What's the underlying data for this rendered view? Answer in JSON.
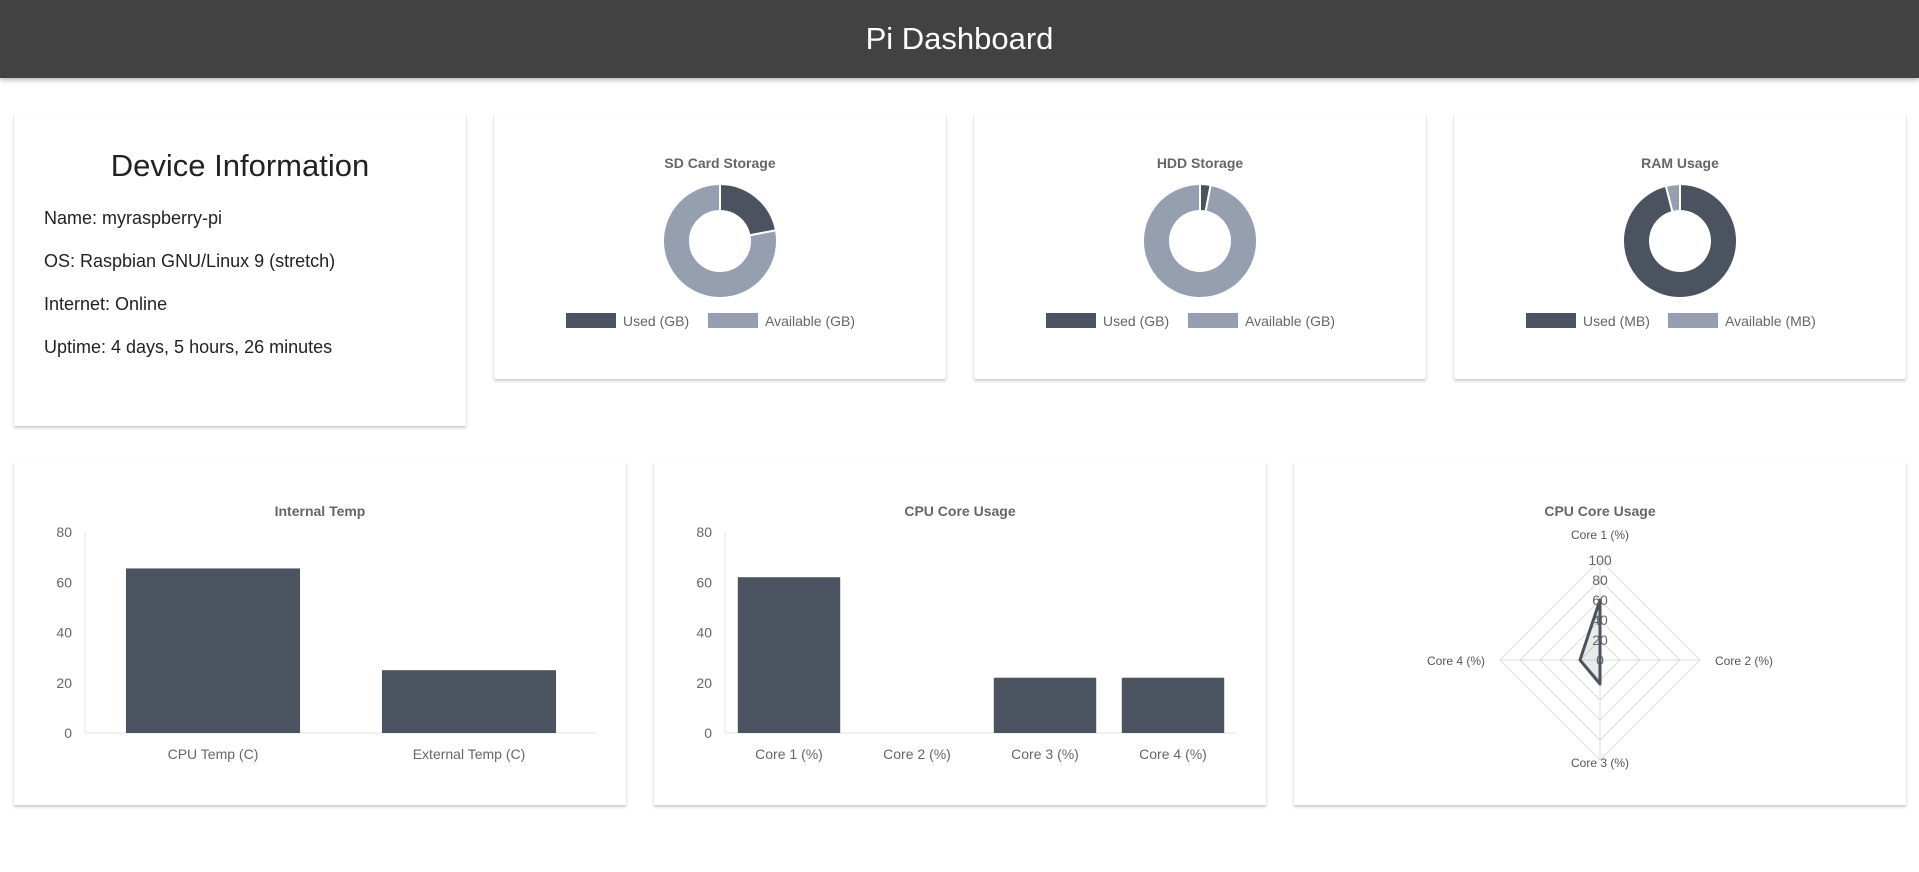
{
  "header": {
    "title": "Pi Dashboard"
  },
  "device": {
    "title": "Device Information",
    "name": "Name: myraspberry-pi",
    "os": "OS: Raspbian GNU/Linux 9 (stretch)",
    "internet": "Internet: Online",
    "uptime": "Uptime: 4 days, 5 hours, 26 minutes"
  },
  "colors": {
    "used": "#4b5260",
    "available": "#959fb0"
  },
  "chart_data": [
    {
      "type": "pie",
      "title": "SD Card Storage",
      "labels": [
        "Used (GB)",
        "Available (GB)"
      ],
      "values": [
        22,
        78
      ]
    },
    {
      "type": "pie",
      "title": "HDD Storage",
      "labels": [
        "Used (GB)",
        "Available (GB)"
      ],
      "values": [
        3,
        97
      ]
    },
    {
      "type": "pie",
      "title": "RAM Usage",
      "labels": [
        "Used (MB)",
        "Available (MB)"
      ],
      "values": [
        96,
        4
      ]
    },
    {
      "type": "bar",
      "title": "Internal Temp",
      "categories": [
        "CPU Temp (C)",
        "External Temp (C)"
      ],
      "values": [
        65.5,
        25
      ],
      "ylim": [
        0,
        80
      ],
      "yticks": [
        0,
        20,
        40,
        60,
        80
      ]
    },
    {
      "type": "bar",
      "title": "CPU Core Usage",
      "categories": [
        "Core 1 (%)",
        "Core 2 (%)",
        "Core 3 (%)",
        "Core 4 (%)"
      ],
      "values": [
        62,
        0,
        22,
        22
      ],
      "ylim": [
        0,
        80
      ],
      "yticks": [
        0,
        20,
        40,
        60,
        80
      ]
    },
    {
      "type": "radar",
      "title": "CPU Core Usage",
      "categories": [
        "Core 1 (%)",
        "Core 2 (%)",
        "Core 3 (%)",
        "Core 4 (%)"
      ],
      "values": [
        60,
        0,
        24,
        20
      ],
      "rlim": [
        0,
        100
      ],
      "rticks": [
        0,
        20,
        40,
        60,
        80,
        100
      ]
    }
  ]
}
